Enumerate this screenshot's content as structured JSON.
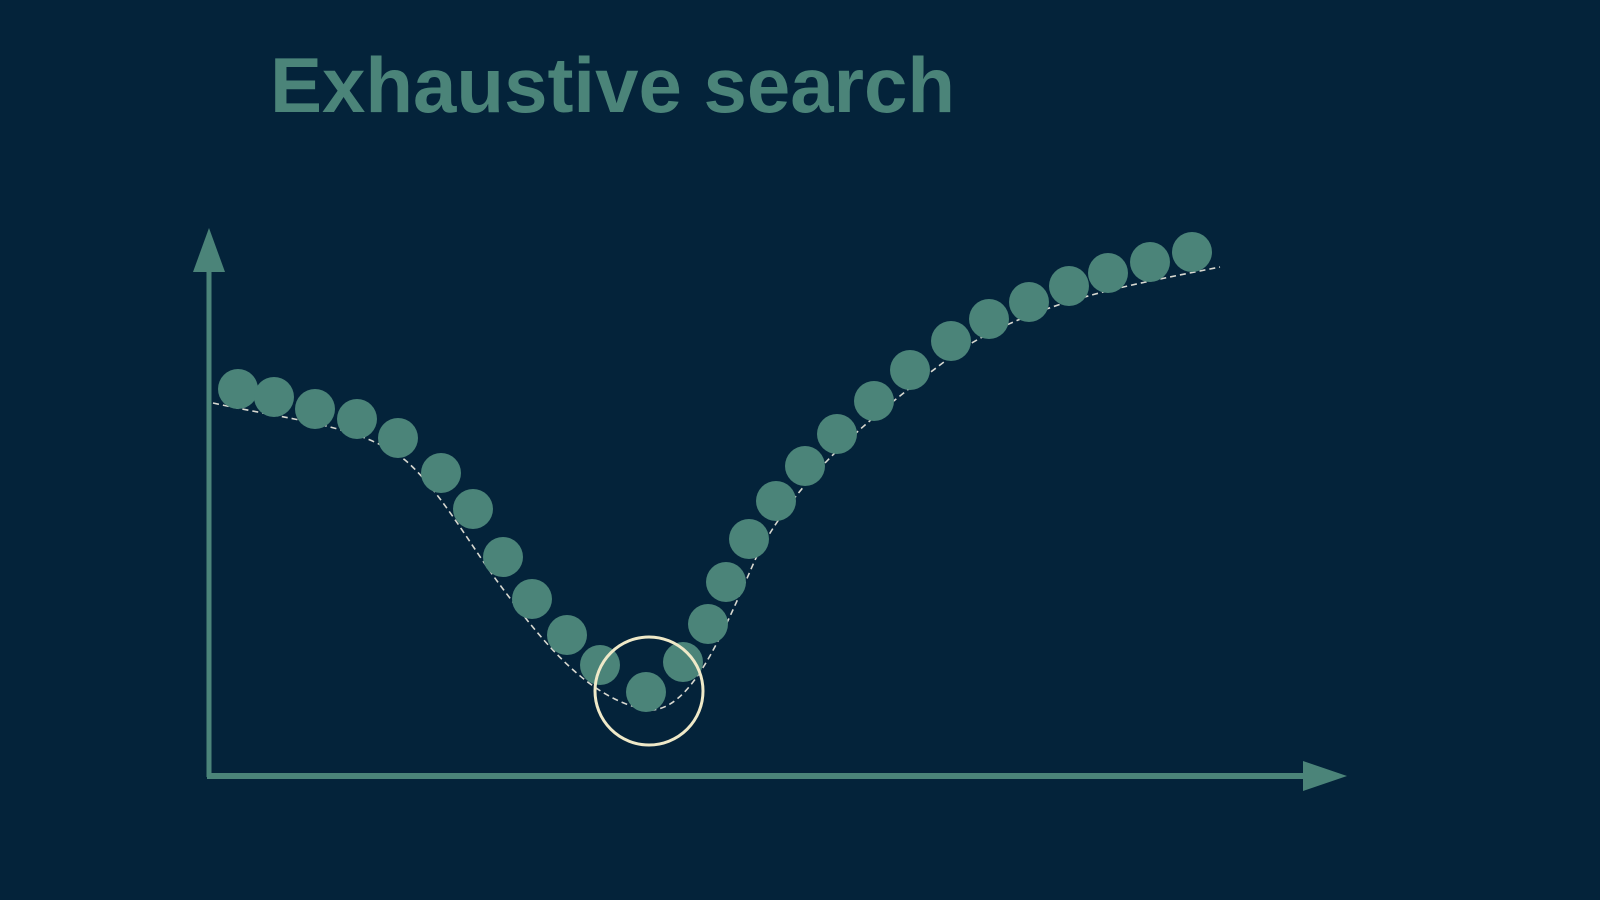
{
  "slide": {
    "title": "Exhaustive search"
  },
  "colors": {
    "background": "#04233a",
    "accent": "#4b8479",
    "curve": "#d8d8d0",
    "highlight": "#efe9c8"
  },
  "diagram": {
    "y_axis_label": "",
    "x_axis_label": "",
    "highlighted_sample_index": 12,
    "sample_count": 27
  }
}
